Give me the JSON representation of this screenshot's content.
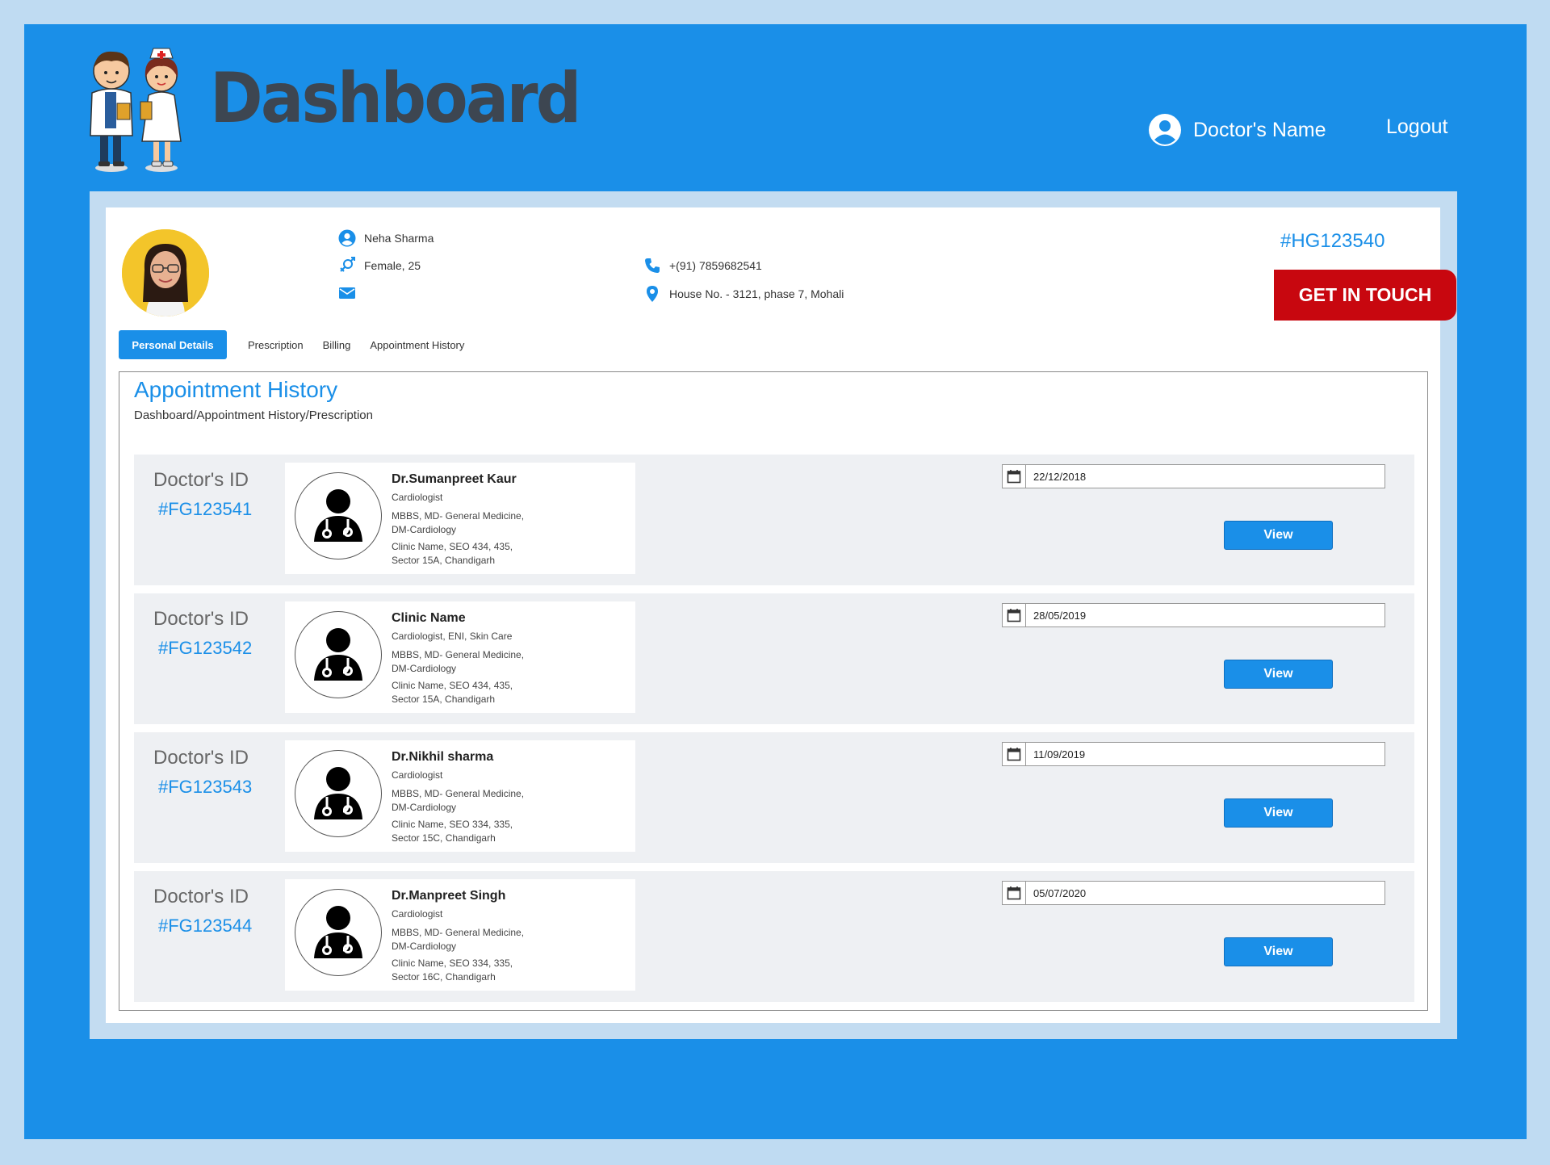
{
  "header": {
    "title": "Dashboard",
    "user_name": "Doctor's Name",
    "logout_label": "Logout"
  },
  "patient": {
    "name": "Neha  Sharma",
    "gender_age": "Female, 25",
    "phone": "+(91) 7859682541",
    "address": "House No. - 3121, phase 7, Mohali",
    "id": "#HG123540"
  },
  "actions": {
    "get_in_touch": "GET IN TOUCH"
  },
  "tabs": [
    {
      "label": "Personal Details",
      "active": true
    },
    {
      "label": "Prescription",
      "active": false
    },
    {
      "label": "Billing",
      "active": false
    },
    {
      "label": "Appointment History",
      "active": false
    }
  ],
  "history": {
    "title": "Appointment History",
    "breadcrumb": "Dashboard/Appointment History/Prescription",
    "id_label": "Doctor's ID",
    "view_label": "View",
    "appointments": [
      {
        "doctor_id": "#FG123541",
        "name": "Dr.Sumanpreet Kaur",
        "specialty": "Cardiologist",
        "edu1": "MBBS, MD- General Medicine,",
        "edu2": "DM-Cardiology",
        "clinic1": "Clinic Name, SEO 434, 435,",
        "clinic2": "Sector 15A, Chandigarh",
        "date": "22/12/2018"
      },
      {
        "doctor_id": "#FG123542",
        "name": "Clinic Name",
        "specialty": "Cardiologist, ENI, Skin Care",
        "edu1": "MBBS, MD- General Medicine,",
        "edu2": "DM-Cardiology",
        "clinic1": "Clinic Name, SEO 434, 435,",
        "clinic2": "Sector 15A, Chandigarh",
        "date": "28/05/2019"
      },
      {
        "doctor_id": "#FG123543",
        "name": "Dr.Nikhil sharma",
        "specialty": "Cardiologist",
        "edu1": "MBBS, MD- General Medicine,",
        "edu2": "DM-Cardiology",
        "clinic1": "Clinic Name, SEO 334, 335,",
        "clinic2": "Sector 15C, Chandigarh",
        "date": "11/09/2019"
      },
      {
        "doctor_id": "#FG123544",
        "name": "Dr.Manpreet Singh",
        "specialty": "Cardiologist",
        "edu1": "MBBS, MD- General Medicine,",
        "edu2": "DM-Cardiology",
        "clinic1": "Clinic Name, SEO 334, 335,",
        "clinic2": "Sector 16C, Chandigarh",
        "date": "05/07/2020"
      }
    ]
  },
  "colors": {
    "primary": "#1a8fe8",
    "accent": "#c8070f",
    "title": "#3d4651",
    "background": "#bfdbf2"
  }
}
